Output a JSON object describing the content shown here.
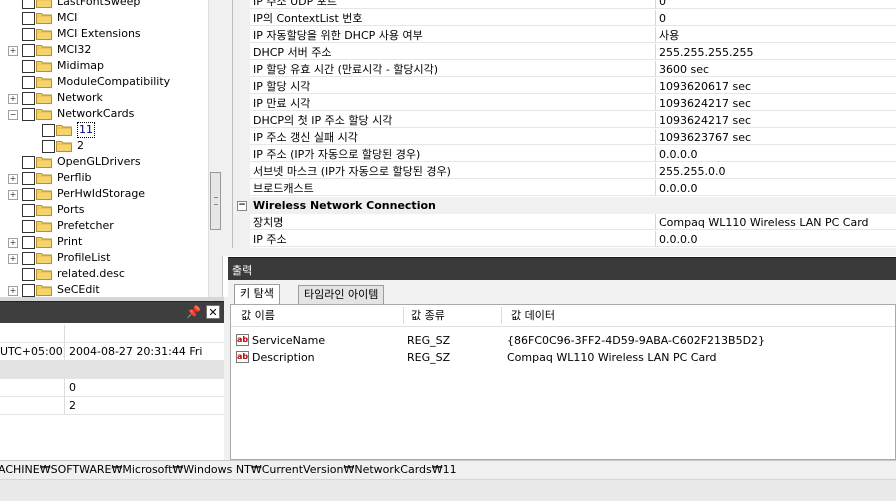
{
  "tree": {
    "items": [
      {
        "label": "LastFontSweep",
        "expander": "",
        "level": 0
      },
      {
        "label": "MCI",
        "expander": "",
        "level": 0
      },
      {
        "label": "MCI Extensions",
        "expander": "",
        "level": 0
      },
      {
        "label": "MCI32",
        "expander": "+",
        "level": 0
      },
      {
        "label": "Midimap",
        "expander": "",
        "level": 0
      },
      {
        "label": "ModuleCompatibility",
        "expander": "",
        "level": 0
      },
      {
        "label": "Network",
        "expander": "+",
        "level": 0
      },
      {
        "label": "NetworkCards",
        "expander": "−",
        "level": 0
      },
      {
        "label": "11",
        "expander": "",
        "level": 1,
        "selected": true
      },
      {
        "label": "2",
        "expander": "",
        "level": 1
      },
      {
        "label": "OpenGLDrivers",
        "expander": "",
        "level": 0
      },
      {
        "label": "Perflib",
        "expander": "+",
        "level": 0
      },
      {
        "label": "PerHwIdStorage",
        "expander": "+",
        "level": 0
      },
      {
        "label": "Ports",
        "expander": "",
        "level": 0
      },
      {
        "label": "Prefetcher",
        "expander": "",
        "level": 0
      },
      {
        "label": "Print",
        "expander": "+",
        "level": 0
      },
      {
        "label": "ProfileList",
        "expander": "+",
        "level": 0
      },
      {
        "label": "related.desc",
        "expander": "",
        "level": 0
      },
      {
        "label": "SeCEdit",
        "expander": "+",
        "level": 0
      }
    ]
  },
  "left_lower": {
    "rows": [
      {
        "c1": "",
        "c2": "",
        "gray": false
      },
      {
        "c1": "UTC+05:00)",
        "c2": "2004-08-27  20:31:44  Fri",
        "gray": false
      },
      {
        "c1": "",
        "c2": "",
        "gray": true
      },
      {
        "c1": "",
        "c2": "0",
        "gray": false
      },
      {
        "c1": "",
        "c2": "2",
        "gray": false
      }
    ]
  },
  "properties": {
    "rows": [
      {
        "name": "IP 주소 UDP 포트",
        "value": "0"
      },
      {
        "name": "IP의 ContextList 번호",
        "value": "0"
      },
      {
        "name": "IP 자동할당을 위한 DHCP 사용 여부",
        "value": "사용"
      },
      {
        "name": "DHCP 서버 주소",
        "value": "255.255.255.255"
      },
      {
        "name": "IP 할당 유효 시간 (만료시각 - 할당시각)",
        "value": "3600 sec"
      },
      {
        "name": "IP 할당 시각",
        "value": "1093620617 sec"
      },
      {
        "name": "IP 만료 시각",
        "value": "1093624217 sec"
      },
      {
        "name": "DHCP의 첫 IP 주소 할당 시각",
        "value": "1093624217 sec"
      },
      {
        "name": "IP 주소 갱신 실패 시각",
        "value": "1093623767 sec"
      },
      {
        "name": "IP 주소 (IP가 자동으로 할당된 경우)",
        "value": "0.0.0.0"
      },
      {
        "name": "서브넷 마스크 (IP가 자동으로 할당된 경우)",
        "value": "255.255.0.0"
      },
      {
        "name": "브로드캐스트",
        "value": "0.0.0.0"
      }
    ],
    "category": {
      "label": "Wireless Network Connection",
      "toggle": "−"
    },
    "category_rows": [
      {
        "name": "장치명",
        "value": "Compaq WL110 Wireless LAN PC Card"
      },
      {
        "name": "IP 주소",
        "value": "0.0.0.0"
      }
    ]
  },
  "output": {
    "title": "출력",
    "tabs": [
      {
        "label": "키 탐색",
        "active": true
      },
      {
        "label": "타임라인 아이템",
        "active": false
      }
    ],
    "columns": {
      "name": "값 이름",
      "type": "값 종류",
      "data": "값 데이터"
    },
    "rows": [
      {
        "icon": "ab",
        "name": "ServiceName",
        "type": "REG_SZ",
        "data": "{86FC0C96-3FF2-4D59-9ABA-C602F213B5D2}"
      },
      {
        "icon": "ab",
        "name": "Description",
        "type": "REG_SZ",
        "data": "Compaq WL110 Wireless LAN PC Card"
      }
    ]
  },
  "left_header": {
    "close": "✕"
  },
  "status": {
    "path": "ACHINE₩SOFTWARE₩Microsoft₩Windows NT₩CurrentVersion₩NetworkCards₩11"
  },
  "colors": {
    "header_bg": "#3a3a3a",
    "selection": "#000080",
    "folder": "#f5d56b"
  }
}
